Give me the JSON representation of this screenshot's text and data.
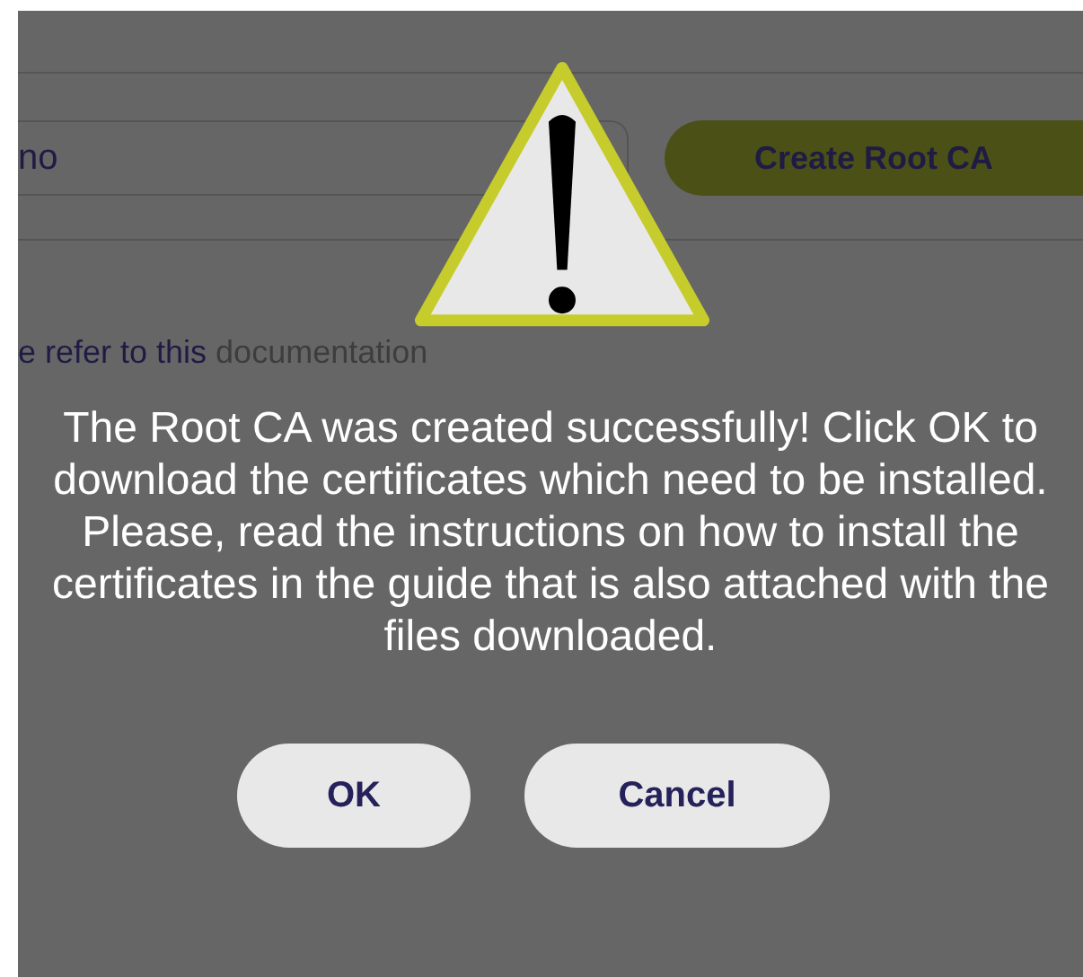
{
  "background": {
    "name_field": {
      "value": "no"
    },
    "create_button": {
      "label": "Create Root CA"
    },
    "note": {
      "text": "e refer to this",
      "link": "documentation"
    }
  },
  "dialog": {
    "message": "The Root CA was created successfully! Click OK to download the certificates which need to be installed. Please, read the instructions on how to install the certificates in the guide that is also attached with the files downloaded.",
    "buttons": [
      {
        "label": "OK"
      },
      {
        "label": "Cancel"
      }
    ]
  }
}
